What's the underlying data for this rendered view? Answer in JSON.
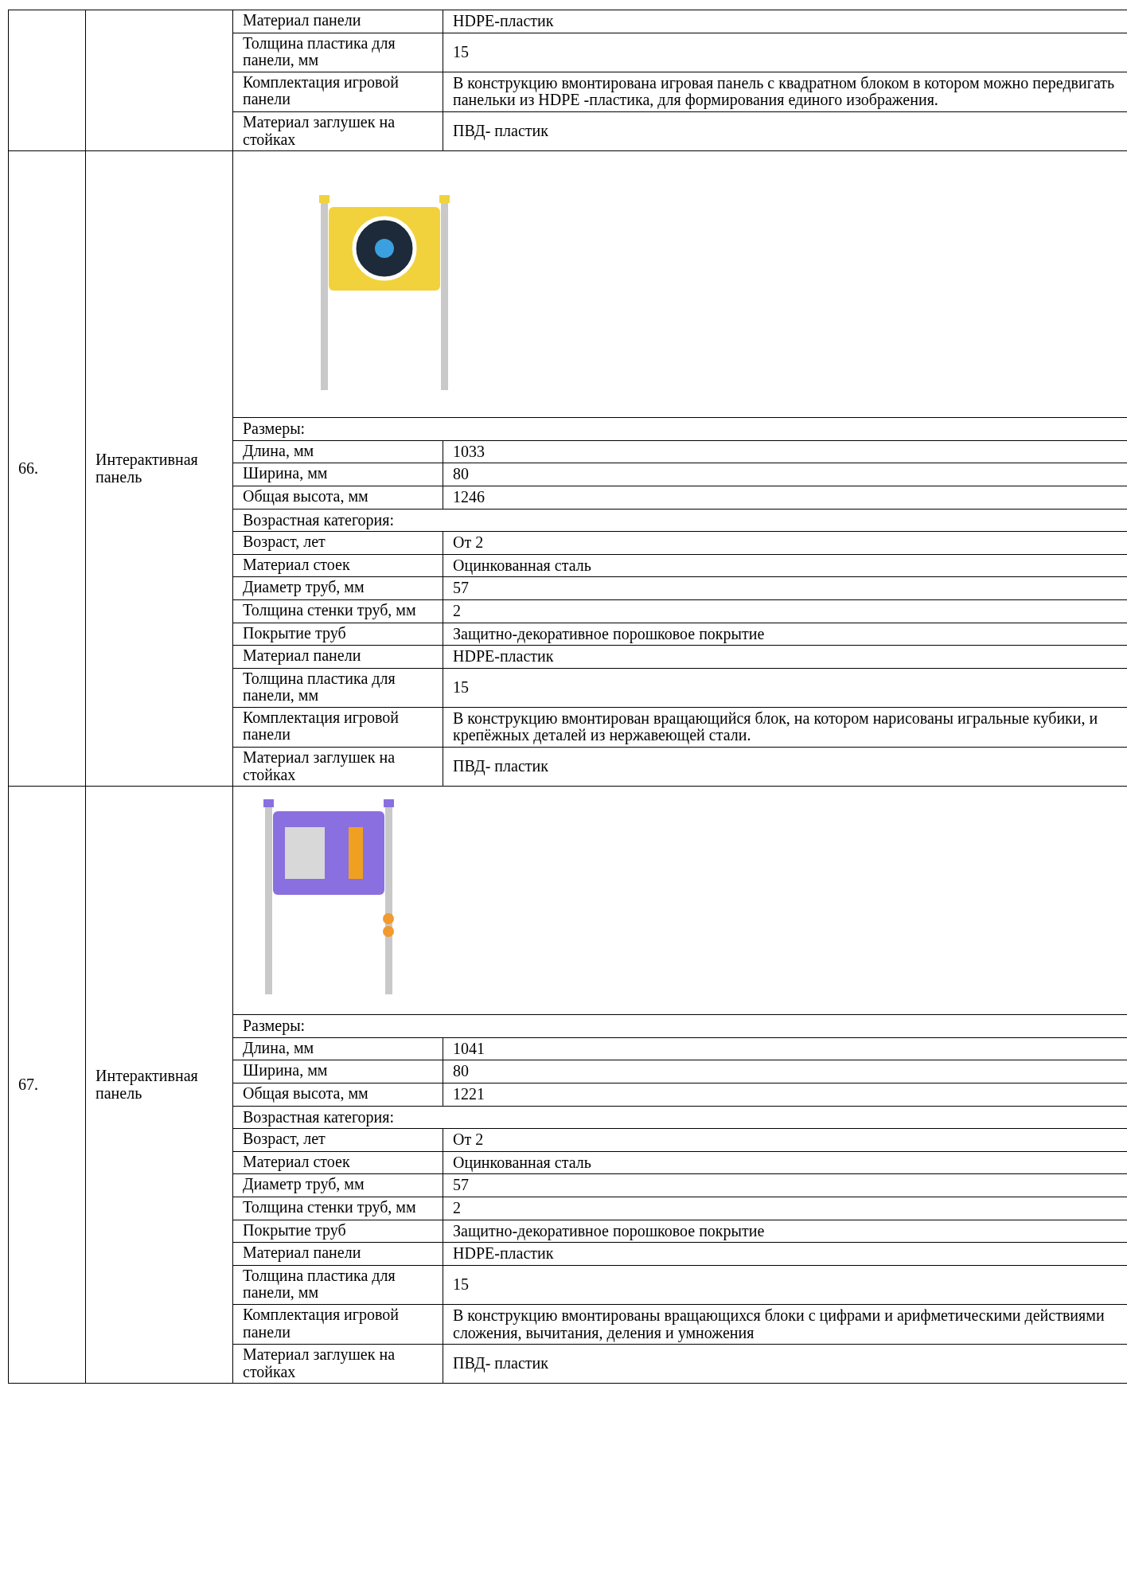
{
  "table": {
    "rows": [
      {
        "specs": [
          {
            "kind": "pair",
            "label": "Материал панели",
            "value": "HDPE-пластик"
          },
          {
            "kind": "pair",
            "label": "Толщина пластика для панели, мм",
            "value": "15"
          },
          {
            "kind": "pair",
            "label": "Комплектация игровой панели",
            "value": "В конструкцию вмонтирована игровая панель с квадратном блоком в котором можно передвигать панельки из HDPE -пластика, для формирования единого изображения."
          },
          {
            "kind": "pair",
            "label": "Материал заглушек на стойках",
            "value": "ПВД- пластик"
          }
        ]
      },
      {
        "number": "66.",
        "name": "Интерактивная панель",
        "specs": [
          {
            "kind": "image",
            "color": "#f2d23c"
          },
          {
            "kind": "heading",
            "label": "Размеры:"
          },
          {
            "kind": "pair",
            "label": "Длина, мм",
            "value": "1033"
          },
          {
            "kind": "pair",
            "label": "Ширина, мм",
            "value": "80"
          },
          {
            "kind": "pair",
            "label": "Общая высота, мм",
            "value": "1246"
          },
          {
            "kind": "heading",
            "label": "Возрастная категория:"
          },
          {
            "kind": "pair",
            "label": "Возраст, лет",
            "value": "От 2"
          },
          {
            "kind": "pair",
            "label": "Материал стоек",
            "value": "Оцинкованная сталь"
          },
          {
            "kind": "pair",
            "label": "Диаметр труб, мм",
            "value": "57"
          },
          {
            "kind": "pair",
            "label": "Толщина стенки труб, мм",
            "value": "2"
          },
          {
            "kind": "pair",
            "label": "Покрытие труб",
            "value": "Защитно-декоративное порошковое покрытие"
          },
          {
            "kind": "pair",
            "label": "Материал панели",
            "value": "HDPE-пластик"
          },
          {
            "kind": "pair",
            "label": "Толщина пластика для панели, мм",
            "value": "15"
          },
          {
            "kind": "pair",
            "label": "Комплектация игровой панели",
            "value": "В конструкцию вмонтирован вращающийся блок, на котором нарисованы игральные кубики, и крепёжных деталей из нержавеющей стали."
          },
          {
            "kind": "pair",
            "label": "Материал заглушек на стойках",
            "value": "ПВД- пластик"
          }
        ]
      },
      {
        "number": "67.",
        "name": "Интерактивная панель",
        "specs": [
          {
            "kind": "image",
            "color": "#8a6fe0"
          },
          {
            "kind": "heading",
            "label": "Размеры:"
          },
          {
            "kind": "pair",
            "label": "Длина, мм",
            "value": "1041"
          },
          {
            "kind": "pair",
            "label": "Ширина, мм",
            "value": "80"
          },
          {
            "kind": "pair",
            "label": "Общая высота, мм",
            "value": "1221"
          },
          {
            "kind": "heading",
            "label": "Возрастная категория:"
          },
          {
            "kind": "pair",
            "label": "Возраст, лет",
            "value": "От 2"
          },
          {
            "kind": "pair",
            "label": "Материал стоек",
            "value": "Оцинкованная сталь"
          },
          {
            "kind": "pair",
            "label": "Диаметр труб, мм",
            "value": "57"
          },
          {
            "kind": "pair",
            "label": "Толщина стенки труб, мм",
            "value": "2"
          },
          {
            "kind": "pair",
            "label": "Покрытие труб",
            "value": "Защитно-декоративное порошковое покрытие"
          },
          {
            "kind": "pair",
            "label": "Материал панели",
            "value": "HDPE-пластик"
          },
          {
            "kind": "pair",
            "label": "Толщина пластика для панели, мм",
            "value": "15"
          },
          {
            "kind": "pair",
            "label": "Комплектация игровой панели",
            "value": "В конструкцию вмонтированы вращающихся блоки с цифрами и арифметическими действиями сложения, вычитания, деления и умножения"
          },
          {
            "kind": "pair",
            "label": "Материал заглушек на стойках",
            "value": "ПВД- пластик"
          }
        ]
      }
    ]
  }
}
